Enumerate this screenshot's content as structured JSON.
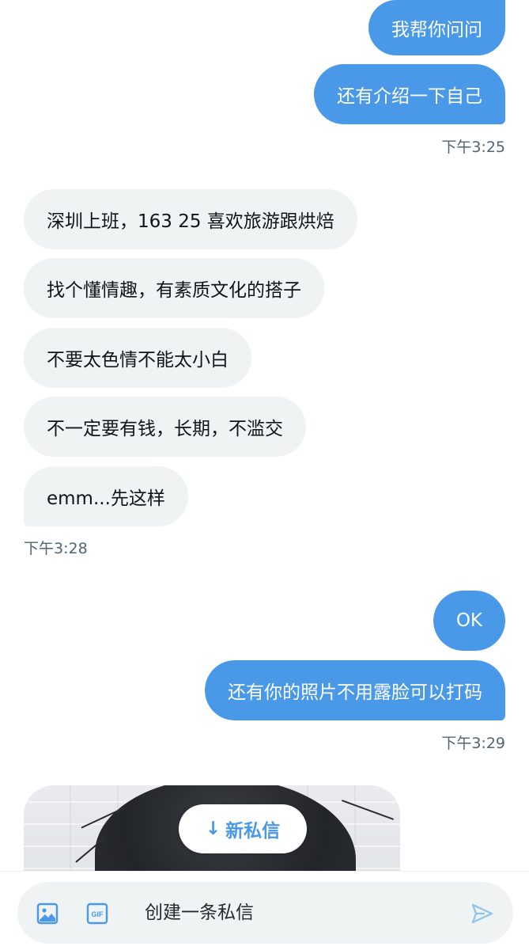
{
  "messages": [
    {
      "id": "m1",
      "direction": "outgoing",
      "text": "我帮你问问"
    },
    {
      "id": "m2",
      "direction": "outgoing",
      "text": "还有介绍一下自己"
    },
    {
      "id": "m3",
      "direction": "incoming",
      "text": "深圳上班，163 25 喜欢旅游跟烘焙"
    },
    {
      "id": "m4",
      "direction": "incoming",
      "text": "找个懂情趣，有素质文化的搭子"
    },
    {
      "id": "m5",
      "direction": "incoming",
      "text": "不要太色情不能太小白"
    },
    {
      "id": "m6",
      "direction": "incoming",
      "text": "不一定要有钱，长期，不滥交"
    },
    {
      "id": "m7",
      "direction": "incoming",
      "text": "emm...先这样"
    },
    {
      "id": "m8",
      "direction": "outgoing",
      "text": "OK"
    },
    {
      "id": "m9",
      "direction": "outgoing",
      "text": "还有你的照片不用露脸可以打码"
    }
  ],
  "timestamps": {
    "t1": "下午3:25",
    "t2": "下午3:28",
    "t3": "下午3:29"
  },
  "new_messages_pill": {
    "arrow": "↓",
    "label": "新私信"
  },
  "composer": {
    "placeholder": "创建一条私信",
    "icons": [
      "image-icon",
      "gif-icon",
      "send-icon"
    ],
    "gif_label": "GIF"
  },
  "colors": {
    "accent": "#4a99e9",
    "incoming_bubble": "#eff3f4",
    "text": "#0f1419",
    "muted": "#536471"
  }
}
